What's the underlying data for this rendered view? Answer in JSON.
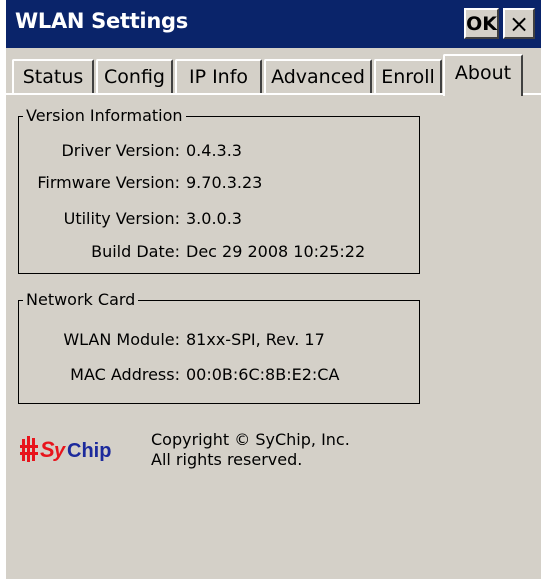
{
  "window": {
    "title": "WLAN Settings",
    "ok_label": "OK",
    "close_label": "×"
  },
  "tabs": [
    {
      "label": "Status"
    },
    {
      "label": "Config"
    },
    {
      "label": "IP Info"
    },
    {
      "label": "Advanced"
    },
    {
      "label": "Enroll"
    },
    {
      "label": "About",
      "active": true
    }
  ],
  "version_info": {
    "title": "Version Information",
    "rows": [
      {
        "label": "Driver Version:",
        "value": "0.4.3.3"
      },
      {
        "label": "Firmware Version:",
        "value": "9.70.3.23"
      },
      {
        "label": "Utility Version:",
        "value": "3.0.0.3"
      },
      {
        "label": "Build Date:",
        "value": "Dec 29 2008 10:25:22"
      }
    ]
  },
  "network_card": {
    "title": "Network Card",
    "rows": [
      {
        "label": "WLAN Module:",
        "value": "81xx-SPI, Rev. 17"
      },
      {
        "label": "MAC Address:",
        "value": "00:0B:6C:8B:E2:CA"
      }
    ]
  },
  "footer": {
    "logo_text": "SyChip",
    "copyright_line1": "Copyright © SyChip, Inc.",
    "copyright_line2": "All rights reserved."
  },
  "colors": {
    "titlebar": "#0a246a",
    "window_bg": "#d4d0c8",
    "logo_red": "#e8141c",
    "logo_blue": "#1c2a9c"
  }
}
